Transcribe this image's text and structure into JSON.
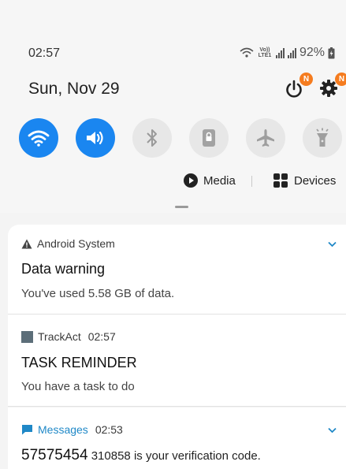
{
  "status_bar": {
    "time": "02:57",
    "volte_label": "Vo)) LTE1",
    "battery": "92%"
  },
  "header": {
    "date": "Sun, Nov 29",
    "power_badge": "N",
    "settings_badge": "N"
  },
  "quick_toggles": [
    {
      "name": "wifi",
      "icon": "wifi-icon",
      "state": "on"
    },
    {
      "name": "sound",
      "icon": "volume-icon",
      "state": "on"
    },
    {
      "name": "bluetooth",
      "icon": "bluetooth-icon",
      "state": "off"
    },
    {
      "name": "portrait",
      "icon": "rotation-lock-icon",
      "state": "off"
    },
    {
      "name": "airplane",
      "icon": "airplane-icon",
      "state": "off"
    },
    {
      "name": "flashlight",
      "icon": "flashlight-icon",
      "state": "off"
    }
  ],
  "media_bar": {
    "media_label": "Media",
    "devices_label": "Devices"
  },
  "notifications": [
    {
      "app": "Android System",
      "time": "",
      "title": "Data warning",
      "body": "You've used 5.58 GB of data.",
      "icon": "warning-icon",
      "expandable": true
    },
    {
      "app": "TrackAct",
      "time": "02:57",
      "title": "TASK REMINDER",
      "body": "You have a task to do",
      "icon": "trackact-app-icon",
      "expandable": false
    },
    {
      "app": "Messages",
      "time": "02:53",
      "sender": "57575454",
      "body": "310858 is your verification code.",
      "icon": "message-icon",
      "expandable": true
    }
  ],
  "colors": {
    "accent_blue": "#1a86f0",
    "badge_orange": "#f57c1f",
    "messages_blue": "#1f88c7",
    "toggle_off": "#e7e7e7"
  }
}
